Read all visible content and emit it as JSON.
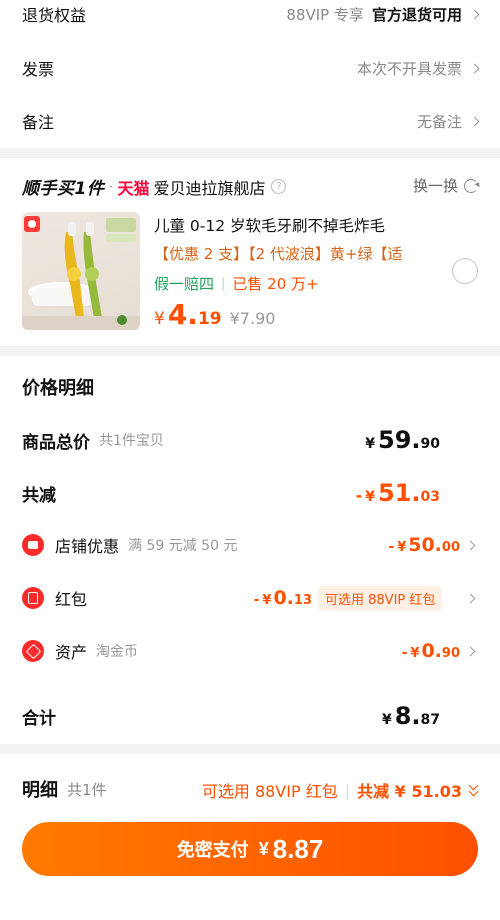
{
  "top": {
    "returns": {
      "label": "退货权益",
      "tag": "88VIP 专享",
      "value": "官方退货可用"
    },
    "invoice": {
      "label": "发票",
      "value": "本次不开具发票"
    },
    "note": {
      "label": "备注",
      "value": "无备注"
    }
  },
  "buy_one": {
    "slogan": "顺手买1件",
    "dot": "·",
    "tmall": "天猫",
    "store": "爱贝迪拉旗舰店",
    "help_icon": "?",
    "swap_label": "换一换",
    "product": {
      "title": "儿童 0-12 岁软毛牙刷不掉毛炸毛",
      "tags": "【优惠 2 支】【2 代波浪】黄+绿【适",
      "promo": "假一赔四",
      "sold": "已售 20 万+",
      "price_yen": "¥",
      "price_int": "4.",
      "price_dec": "19",
      "original_price": "¥7.90"
    }
  },
  "detail": {
    "title": "价格明细",
    "goods_total": {
      "label": "商品总价",
      "sub": "共1件宝贝",
      "yen": "¥",
      "int": "59.",
      "dec": "90"
    },
    "discount_total": {
      "label": "共减",
      "sign": "-",
      "yen": "¥",
      "int": "51.",
      "dec": "03"
    },
    "store_discount": {
      "label": "店铺优惠",
      "sub": "满 59 元减 50 元",
      "sign": "-",
      "yen": "¥",
      "int": "50.",
      "dec": "00"
    },
    "red_packet": {
      "label": "红包",
      "sign": "-",
      "yen": "¥",
      "int": "0.",
      "dec": "13",
      "badge": "可选用 88VIP 红包"
    },
    "asset": {
      "label": "资产",
      "sub": "淘金币",
      "sign": "-",
      "yen": "¥",
      "int": "0.",
      "dec": "90"
    },
    "sum": {
      "label": "合计",
      "yen": "¥",
      "int": "8.",
      "dec": "87"
    }
  },
  "bottom": {
    "detail_label": "明细",
    "count": "共1件",
    "vip_hint": "可选用 88VIP 红包",
    "total_discount": "共减 ¥ 51.03",
    "pay_label": "免密支付",
    "pay_yen": "¥",
    "pay_amount": "8.87"
  },
  "colors": {
    "accent": "#ff5000",
    "tmall_red": "#ff0036",
    "promo_green": "#1fa35a"
  }
}
